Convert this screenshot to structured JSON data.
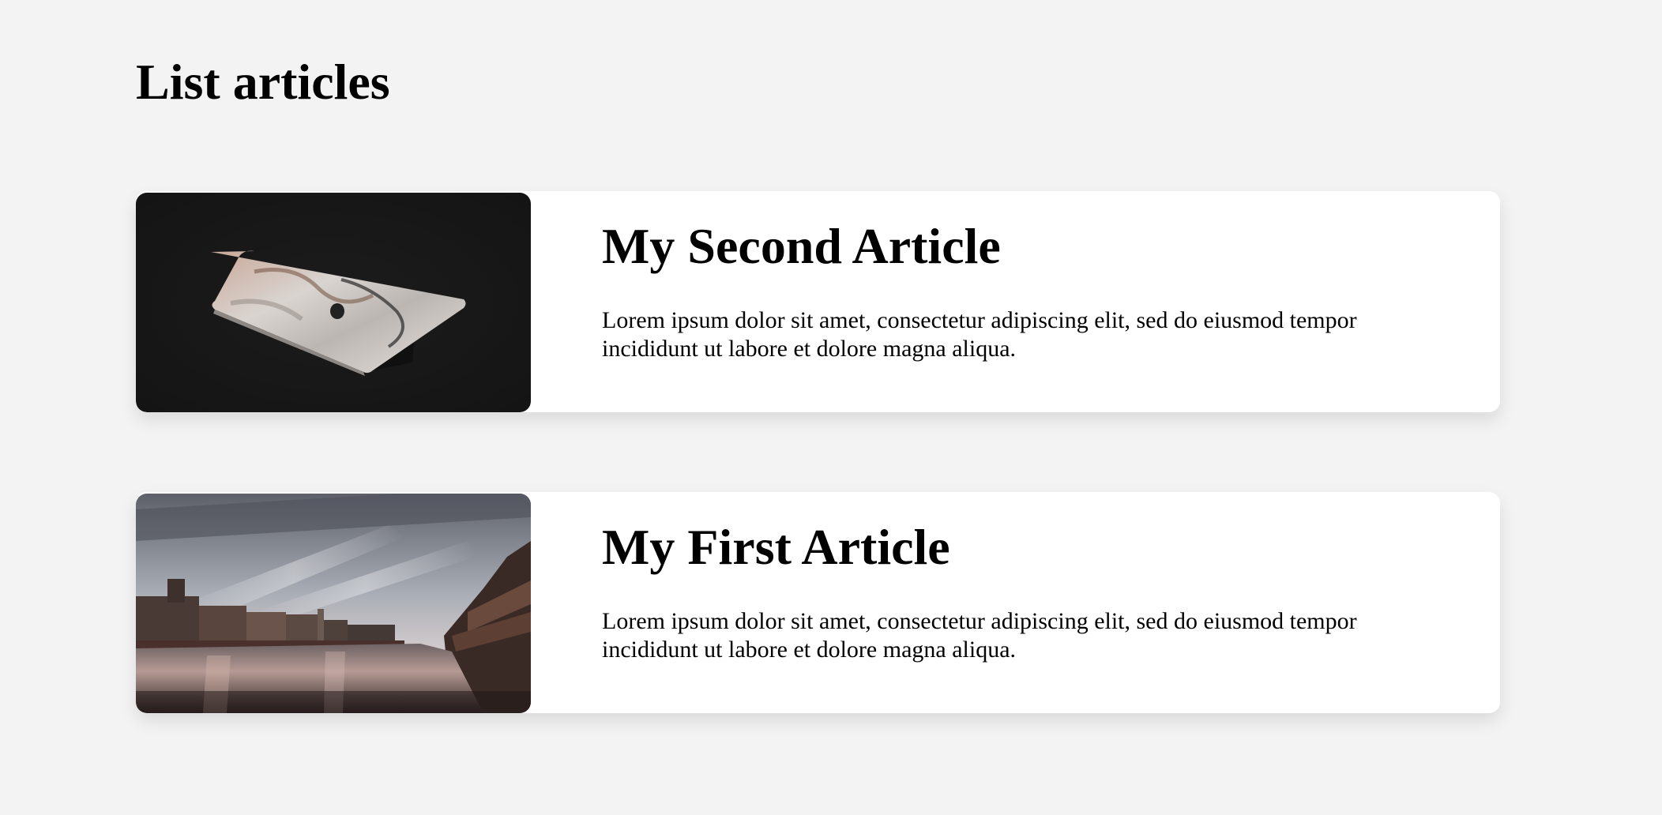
{
  "page": {
    "title": "List articles"
  },
  "articles": [
    {
      "title": "My Second Article",
      "excerpt": "Lorem ipsum dolor sit amet, consectetur adipiscing elit, sed do eiusmod tempor incididunt ut labore et dolore magna aliqua.",
      "image": "laptop-photo"
    },
    {
      "title": "My First Article",
      "excerpt": "Lorem ipsum dolor sit amet, consectetur adipiscing elit, sed do eiusmod tempor incididunt ut labore et dolore magna aliqua.",
      "image": "river-city-photo"
    }
  ]
}
